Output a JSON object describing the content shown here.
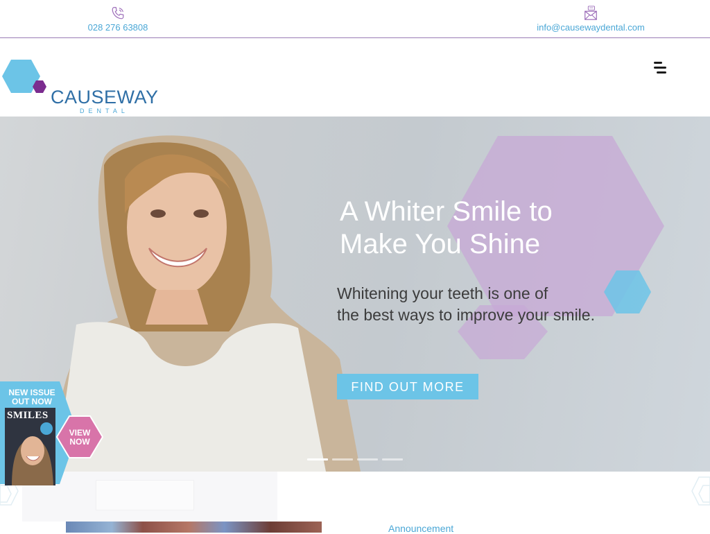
{
  "topbar": {
    "phone": {
      "icon": "phone-icon",
      "text": "028 276 63808"
    },
    "email": {
      "icon": "mail-icon",
      "text": "info@causewaydental.com"
    }
  },
  "header": {
    "logo": {
      "name": "CAUSEWAY",
      "sub": "DENTAL"
    },
    "menu_icon": "hamburger-menu-icon"
  },
  "hero": {
    "title_line1": "A Whiter Smile to",
    "title_line2": "Make You Shine",
    "subtitle_line1": "Whitening your teeth is one of",
    "subtitle_line2": "the best ways to improve your smile.",
    "cta": "FIND OUT MORE",
    "slides_count": 4,
    "active_slide": 1
  },
  "magazine": {
    "badge_line1": "NEW ISSUE",
    "badge_line2": "OUT NOW",
    "cover_title": "SMILES",
    "view_line1": "VIEW",
    "view_line2": "NOW"
  },
  "below": {
    "announcement": "Announcement"
  },
  "colors": {
    "accent_blue": "#6cc4e7",
    "link_blue": "#4aa7d6",
    "brand_purple": "#7b2c8f",
    "hex_lavender": "#c7a8d6",
    "badge_pink": "#d874a9"
  }
}
